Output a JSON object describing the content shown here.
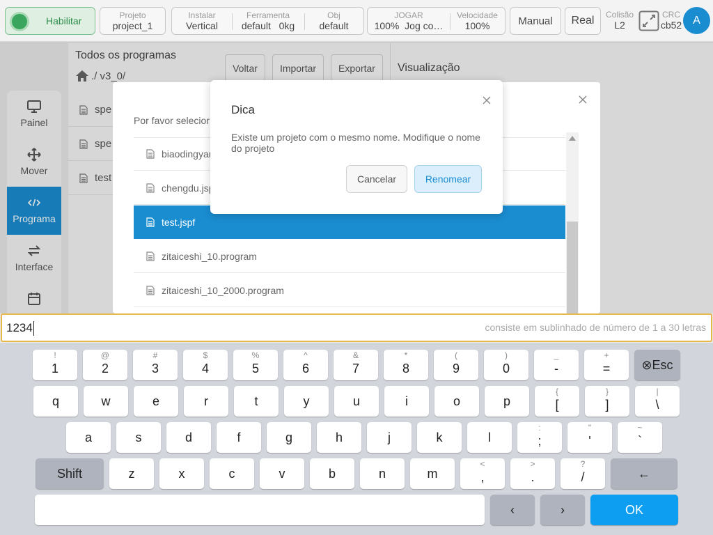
{
  "topbar": {
    "enable_label": "Habilitar",
    "project_label": "Projeto",
    "project_value": "project_1",
    "install_label": "Instalar",
    "install_value": "Vertical",
    "tool_label": "Ferramenta",
    "tool_value": "default",
    "tool_load": "0kg",
    "obj_label": "Obj",
    "obj_value": "default",
    "jog_label": "JOGAR",
    "jog_percent": "100%",
    "jog_mode": "Jog co…",
    "speed_label": "Velocidade",
    "speed_value": "100%",
    "manual_label": "Manual",
    "real_label": "Real",
    "collision_label": "Colisão",
    "collision_value": "L2",
    "crc_label": "CRC",
    "crc_value": "cb52",
    "avatar_letter": "A"
  },
  "nav": {
    "items": [
      {
        "label": "Painel",
        "icon": "monitor-icon"
      },
      {
        "label": "Mover",
        "icon": "move-icon"
      },
      {
        "label": "Programa",
        "icon": "code-icon"
      },
      {
        "label": "Interface",
        "icon": "swap-icon"
      },
      {
        "label": "",
        "icon": "calendar-icon"
      }
    ],
    "active_index": 2
  },
  "programs": {
    "title": "Todos os programas",
    "path": "./ v3_0/",
    "back_label": "Voltar",
    "import_label": "Importar",
    "export_label": "Exportar",
    "rows": [
      "spe",
      "spe",
      "test"
    ]
  },
  "preview": {
    "title": "Visualização"
  },
  "file_dialog": {
    "prompt": "Por favor selecior",
    "files": [
      {
        "name": "biaodingyan",
        "selected": false
      },
      {
        "name": "chengdu.jsp",
        "selected": false
      },
      {
        "name": "test.jspf",
        "selected": true
      },
      {
        "name": "zitaiceshi_10.program",
        "selected": false
      },
      {
        "name": "zitaiceshi_10_2000.program",
        "selected": false
      }
    ]
  },
  "tip_dialog": {
    "title": "Dica",
    "message": "Existe um projeto com o mesmo nome. Modifique o nome do projeto",
    "cancel_label": "Cancelar",
    "rename_label": "Renomear"
  },
  "input": {
    "value": "1234",
    "hint": "consiste em sublinhado de número de 1 a 30 letras"
  },
  "keyboard": {
    "row1": [
      [
        "!",
        "1"
      ],
      [
        "@",
        "2"
      ],
      [
        "#",
        "3"
      ],
      [
        "$",
        "4"
      ],
      [
        "%",
        "5"
      ],
      [
        "^",
        "6"
      ],
      [
        "&",
        "7"
      ],
      [
        "*",
        "8"
      ],
      [
        "(",
        "9"
      ],
      [
        ")",
        "0"
      ],
      [
        "_",
        "-"
      ],
      [
        "+",
        "="
      ]
    ],
    "esc_label": "⊗Esc",
    "row2": [
      [
        "",
        "q"
      ],
      [
        "",
        "w"
      ],
      [
        "",
        "e"
      ],
      [
        "",
        "r"
      ],
      [
        "",
        "t"
      ],
      [
        "",
        "y"
      ],
      [
        "",
        "u"
      ],
      [
        "",
        "i"
      ],
      [
        "",
        "o"
      ],
      [
        "",
        "p"
      ],
      [
        "{",
        "["
      ],
      [
        "}",
        "]"
      ],
      [
        "|",
        "\\"
      ]
    ],
    "row3": [
      [
        "",
        "a"
      ],
      [
        "",
        "s"
      ],
      [
        "",
        "d"
      ],
      [
        "",
        "f"
      ],
      [
        "",
        "g"
      ],
      [
        "",
        "h"
      ],
      [
        "",
        "j"
      ],
      [
        "",
        "k"
      ],
      [
        "",
        "l"
      ],
      [
        ":",
        ";"
      ],
      [
        "\"",
        "'"
      ],
      [
        "~",
        "`"
      ]
    ],
    "shift_label": "Shift",
    "row4": [
      [
        "",
        "z"
      ],
      [
        "",
        "x"
      ],
      [
        "",
        "c"
      ],
      [
        "",
        "v"
      ],
      [
        "",
        "b"
      ],
      [
        "",
        "n"
      ],
      [
        "",
        "m"
      ],
      [
        "<",
        ","
      ],
      [
        ">",
        "."
      ],
      [
        "?",
        "/"
      ]
    ],
    "backspace_label": "←",
    "left_label": "‹",
    "right_label": "›",
    "ok_label": "OK"
  },
  "colors": {
    "accent": "#1a8dd1",
    "ok_button": "#0d9ef2",
    "input_border": "#e8b84a",
    "enable_green": "#3aa55d"
  }
}
